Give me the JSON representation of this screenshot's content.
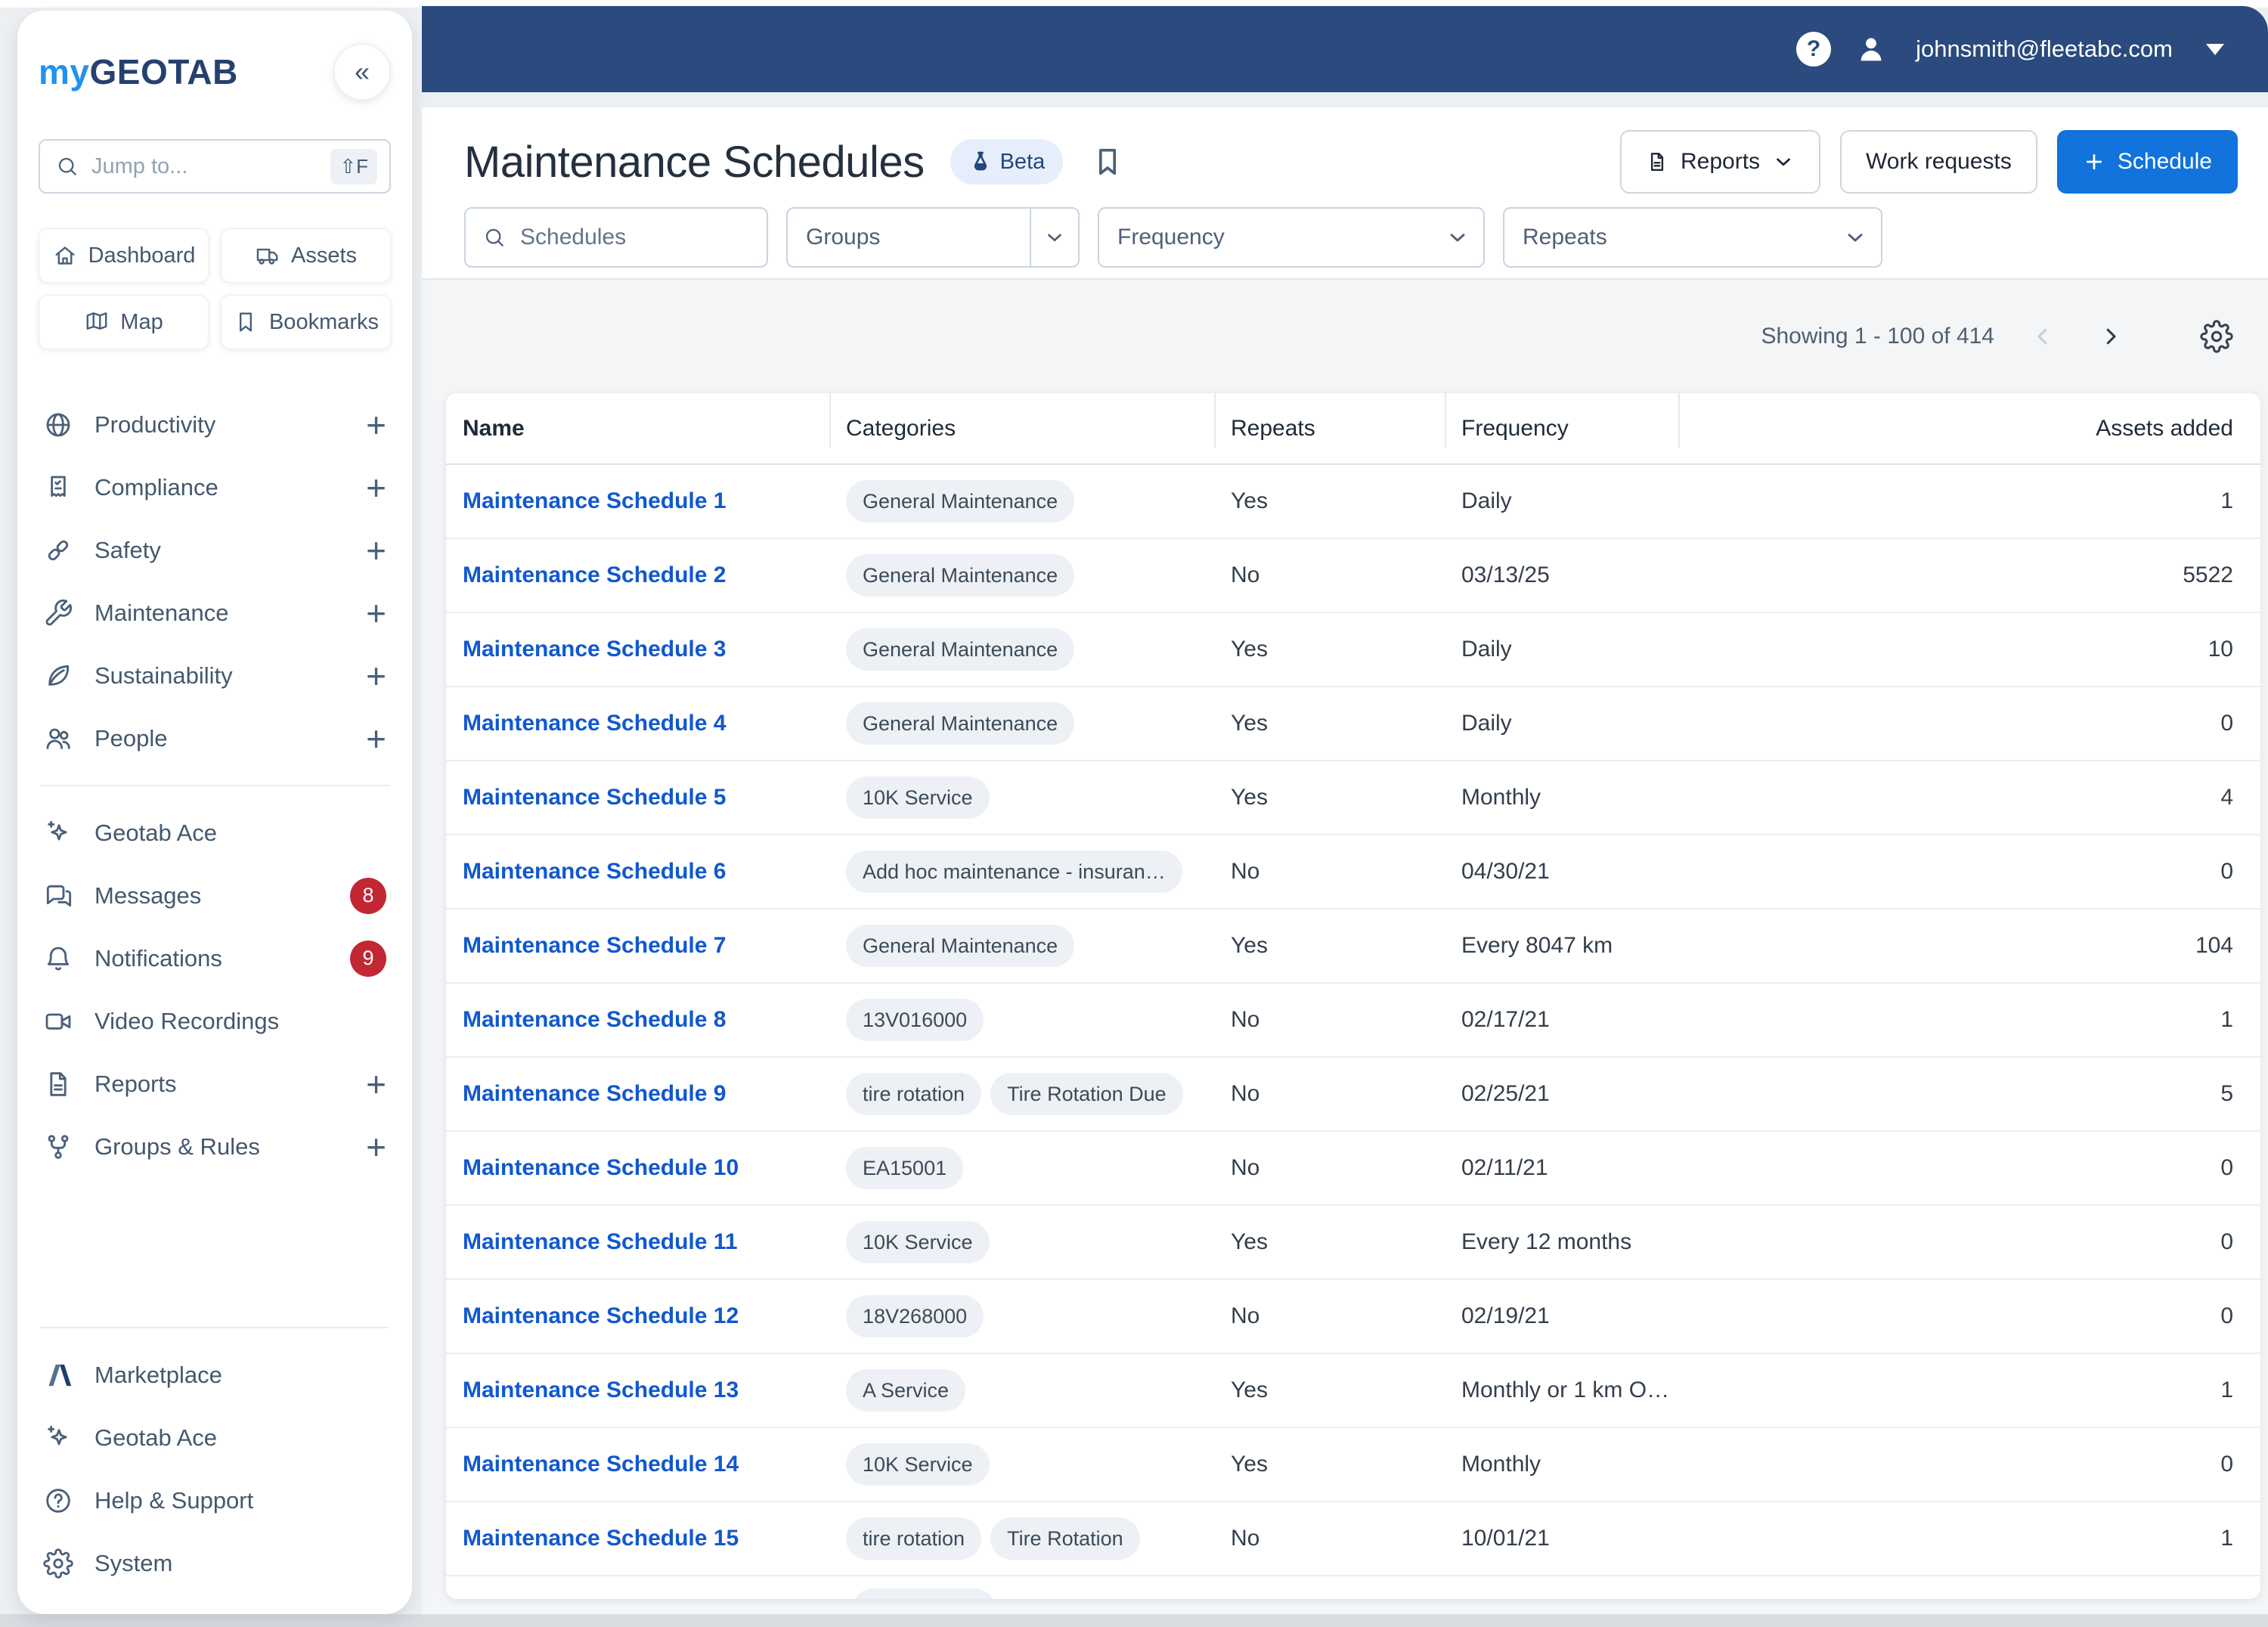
{
  "colors": {
    "topbar_navy": "#2b4a7d",
    "accent_blue": "#1173db",
    "link_blue": "#1158cf",
    "badge_red": "#c22733",
    "logo_blue": "#2192ef",
    "logo_navy": "#25416f",
    "chip_bg": "#edf1f6"
  },
  "icons": {
    "help_glyph": "?",
    "collapse_glyph": "«",
    "plus_glyph": "+"
  },
  "topbar": {
    "email": "johnsmith@fleetabc.com"
  },
  "sidebar": {
    "logo_my": "my",
    "logo_geotab": "GEOTAB",
    "search": {
      "placeholder": "Jump to...",
      "shortcut": "⇧F"
    },
    "quick_links": [
      {
        "label": "Dashboard",
        "icon": "home-icon"
      },
      {
        "label": "Assets",
        "icon": "truck-icon"
      },
      {
        "label": "Map",
        "icon": "map-icon"
      },
      {
        "label": "Bookmarks",
        "icon": "bookmark-icon"
      }
    ],
    "sections": [
      {
        "label": "Productivity",
        "icon": "globe-icon"
      },
      {
        "label": "Compliance",
        "icon": "receipt-check-icon"
      },
      {
        "label": "Safety",
        "icon": "chain-links-icon"
      },
      {
        "label": "Maintenance",
        "icon": "wrench-icon"
      },
      {
        "label": "Sustainability",
        "icon": "leaf-icon"
      },
      {
        "label": "People",
        "icon": "people-icon"
      }
    ],
    "tools": [
      {
        "label": "Geotab Ace",
        "icon": "sparkles-icon"
      },
      {
        "label": "Messages",
        "icon": "chat-icon",
        "badge": "8"
      },
      {
        "label": "Notifications",
        "icon": "bell-icon",
        "badge": "9"
      },
      {
        "label": "Video Recordings",
        "icon": "video-camera-icon"
      },
      {
        "label": "Reports",
        "icon": "document-icon",
        "plus": true
      },
      {
        "label": "Groups & Rules",
        "icon": "hierarchy-icon",
        "plus": true
      }
    ],
    "bottom": [
      {
        "label": "Marketplace",
        "icon": "marketplace-icon"
      },
      {
        "label": "Geotab Ace",
        "icon": "sparkles-icon"
      },
      {
        "label": "Help & Support",
        "icon": "help-circle-icon"
      },
      {
        "label": "System",
        "icon": "gear-icon"
      }
    ]
  },
  "header": {
    "title": "Maintenance Schedules",
    "beta_label": "Beta",
    "reports_button": "Reports",
    "work_requests_button": "Work requests",
    "schedule_button": "Schedule"
  },
  "filters": {
    "search_placeholder": "Schedules",
    "groups_label": "Groups",
    "frequency_label": "Frequency",
    "repeats_label": "Repeats"
  },
  "pagination": {
    "showing": "Showing 1 - 100 of 414"
  },
  "table": {
    "columns": [
      "Name",
      "Categories",
      "Repeats",
      "Frequency",
      "Assets added"
    ],
    "rows": [
      {
        "name": "Maintenance Schedule 1",
        "categories": [
          "General Maintenance"
        ],
        "repeats": "Yes",
        "frequency": "Daily",
        "assets": "1"
      },
      {
        "name": "Maintenance Schedule 2",
        "categories": [
          "General Maintenance"
        ],
        "repeats": "No",
        "frequency": "03/13/25",
        "assets": "5522"
      },
      {
        "name": "Maintenance Schedule 3",
        "categories": [
          "General Maintenance"
        ],
        "repeats": "Yes",
        "frequency": "Daily",
        "assets": "10"
      },
      {
        "name": "Maintenance Schedule 4",
        "categories": [
          "General Maintenance"
        ],
        "repeats": "Yes",
        "frequency": "Daily",
        "assets": "0"
      },
      {
        "name": "Maintenance Schedule 5",
        "categories": [
          "10K Service"
        ],
        "repeats": "Yes",
        "frequency": "Monthly",
        "assets": "4"
      },
      {
        "name": "Maintenance Schedule 6",
        "categories": [
          "Add hoc maintenance - insuran…"
        ],
        "repeats": "No",
        "frequency": "04/30/21",
        "assets": "0"
      },
      {
        "name": "Maintenance Schedule 7",
        "categories": [
          "General Maintenance"
        ],
        "repeats": "Yes",
        "frequency": "Every 8047 km",
        "assets": "104"
      },
      {
        "name": "Maintenance Schedule 8",
        "categories": [
          "13V016000"
        ],
        "repeats": "No",
        "frequency": "02/17/21",
        "assets": "1"
      },
      {
        "name": "Maintenance Schedule 9",
        "categories": [
          "tire rotation",
          "Tire Rotation Due"
        ],
        "repeats": "No",
        "frequency": "02/25/21",
        "assets": "5"
      },
      {
        "name": "Maintenance Schedule 10",
        "categories": [
          "EA15001"
        ],
        "repeats": "No",
        "frequency": "02/11/21",
        "assets": "0"
      },
      {
        "name": "Maintenance Schedule 11",
        "categories": [
          "10K Service"
        ],
        "repeats": "Yes",
        "frequency": "Every 12 months",
        "assets": "0"
      },
      {
        "name": "Maintenance Schedule 12",
        "categories": [
          "18V268000"
        ],
        "repeats": "No",
        "frequency": "02/19/21",
        "assets": "0"
      },
      {
        "name": "Maintenance Schedule 13",
        "categories": [
          "A Service"
        ],
        "repeats": "Yes",
        "frequency": "Monthly or 1 km O…",
        "assets": "1"
      },
      {
        "name": "Maintenance Schedule 14",
        "categories": [
          "10K Service"
        ],
        "repeats": "Yes",
        "frequency": "Monthly",
        "assets": "0"
      },
      {
        "name": "Maintenance Schedule 15",
        "categories": [
          "tire rotation",
          "Tire Rotation"
        ],
        "repeats": "No",
        "frequency": "10/01/21",
        "assets": "1"
      }
    ],
    "partial_row_visible": true
  }
}
